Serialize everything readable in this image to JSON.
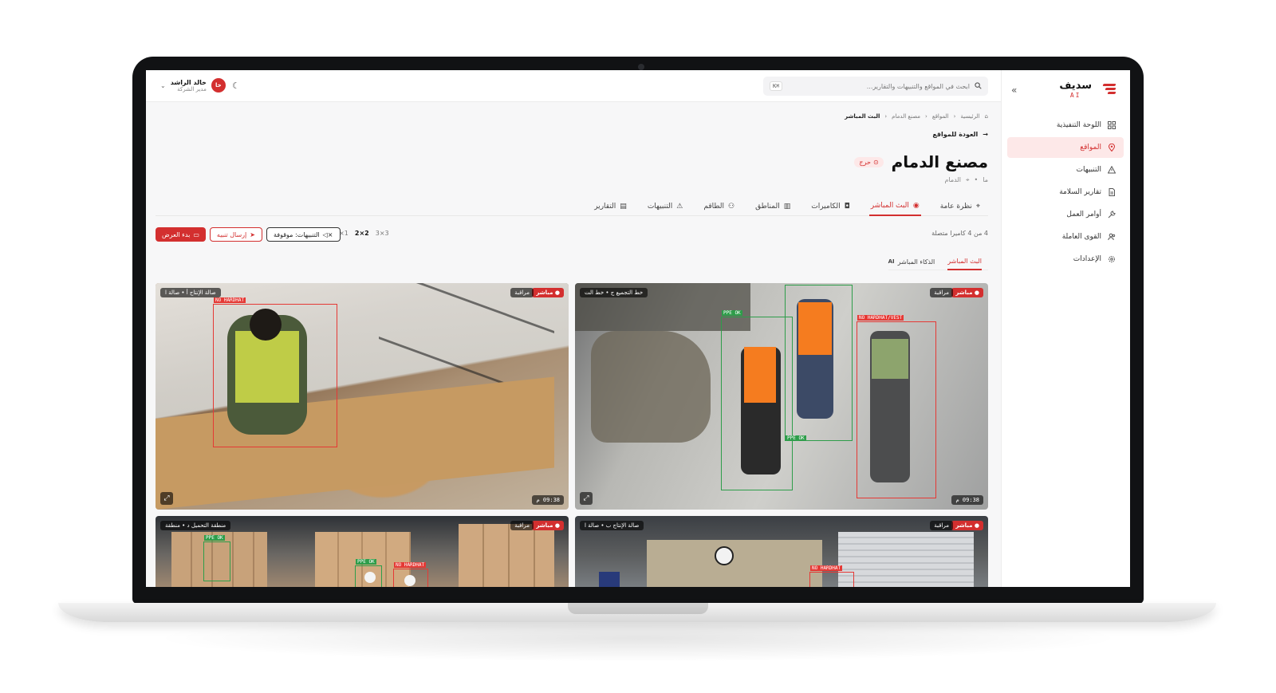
{
  "app": {
    "brand_name": "سديف",
    "brand_suffix": "AI",
    "collapse_icon": "chevrons-right"
  },
  "sidebar": {
    "items": [
      {
        "label": "اللوحة التنفيذية",
        "icon": "grid-icon",
        "active": false
      },
      {
        "label": "المواقع",
        "icon": "map-pin-icon",
        "active": true
      },
      {
        "label": "التنبيهات",
        "icon": "warning-icon",
        "active": false
      },
      {
        "label": "تقارير السلامة",
        "icon": "document-icon",
        "active": false
      },
      {
        "label": "أوامر العمل",
        "icon": "wrench-icon",
        "active": false
      },
      {
        "label": "القوى العاملة",
        "icon": "users-icon",
        "active": false
      },
      {
        "label": "الإعدادات",
        "icon": "gear-icon",
        "active": false
      }
    ]
  },
  "topbar": {
    "search_placeholder": "ابحث في المواقع والتنبيهات والتقارير...",
    "search_shortcut": "⌘K",
    "user_name": "خالد الراشد",
    "user_role": "مدير الشركة",
    "user_initials": "خا"
  },
  "page": {
    "breadcrumb": [
      "الرئيسية",
      "المواقع",
      "مصنع الدمام",
      "البث المباشر"
    ],
    "back_label": "العودة للمواقع",
    "title": "مصنع الدمام",
    "status": "حرج",
    "meta_code": "ما",
    "meta_city": "الدمام"
  },
  "tabs": [
    {
      "label": "نظرة عامة",
      "icon": "map-pin-icon",
      "active": false
    },
    {
      "label": "البث المباشر",
      "icon": "eye-icon",
      "active": true
    },
    {
      "label": "الكاميرات",
      "icon": "camera-icon",
      "active": false
    },
    {
      "label": "المناطق",
      "icon": "map-icon",
      "active": false
    },
    {
      "label": "الطاقم",
      "icon": "users-icon",
      "active": false
    },
    {
      "label": "التنبيهات",
      "icon": "warning-icon",
      "active": false
    },
    {
      "label": "التقارير",
      "icon": "document-icon",
      "active": false
    }
  ],
  "toolbar": {
    "camera_count": "4 من 4 كاميرا متصلة",
    "layouts": [
      "1×1",
      "2×2",
      "3×3"
    ],
    "selected_layout": "2×2",
    "alerts_button": "التنبيهات: موقوفة",
    "send_alert_button": "إرسال تنبيه",
    "start_show_button": "بدء العرض"
  },
  "subtabs": [
    {
      "label": "البث المباشر",
      "active": true
    },
    {
      "label": "الذكاء المباشر",
      "suffix": "AI",
      "active": false
    }
  ],
  "cameras": [
    {
      "live": "● مباشر",
      "monitor": "مراقبة",
      "label": "خط التجميع ج • خط الت",
      "time": "09:38 م",
      "detections": [
        {
          "text": "PPE OK",
          "color": "green"
        },
        {
          "text": "NO HARDHAT/VEST",
          "color": "red"
        },
        {
          "text": "PPE OK",
          "color": "green"
        }
      ]
    },
    {
      "live": "● مباشر",
      "monitor": "مراقبة",
      "label": "صالة الإنتاج أ • صالة ا",
      "time": "09:38 م",
      "detections": [
        {
          "text": "NO HARDHAT",
          "color": "red"
        }
      ]
    },
    {
      "live": "● مباشر",
      "monitor": "مراقبة",
      "label": "صالة الإنتاج ب • صالة ا",
      "detections": [
        {
          "text": "NO HARDHAT",
          "color": "red"
        }
      ]
    },
    {
      "live": "● مباشر",
      "monitor": "مراقبة",
      "label": "منطقة التحميل د • منطقة",
      "detections": [
        {
          "text": "PPE OK",
          "color": "green"
        },
        {
          "text": "PPE OK",
          "color": "green"
        },
        {
          "text": "NO HARDHAT",
          "color": "red"
        }
      ]
    }
  ],
  "colors": {
    "accent": "#d32f2f",
    "ok": "#2e9d4a",
    "alert": "#e53935"
  }
}
